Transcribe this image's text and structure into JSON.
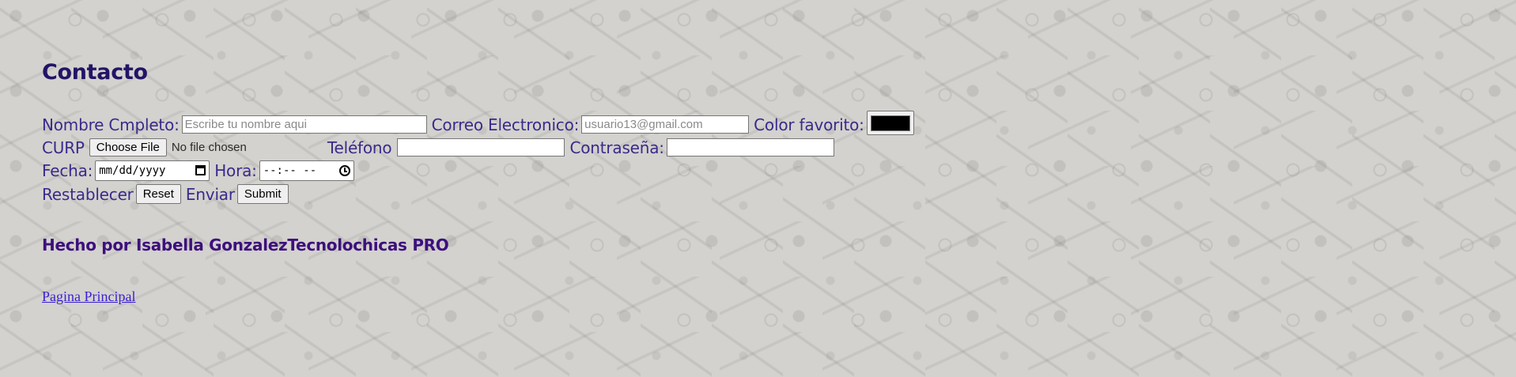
{
  "page": {
    "title": "Contacto",
    "background_color": "#d3d2ce",
    "heading_color": "#221466",
    "label_color": "#3a2a8c"
  },
  "form": {
    "nombre": {
      "label": "Nombre Cmpleto:",
      "placeholder": "Escribe tu nombre aqui",
      "value": ""
    },
    "correo": {
      "label": "Correo Electronico:",
      "placeholder": "usuario13@gmail.com",
      "value": ""
    },
    "color": {
      "label": "Color favorito:",
      "value": "#000000"
    },
    "curp": {
      "label": "CURP",
      "button_label": "Choose File",
      "status": "No file chosen"
    },
    "telefono": {
      "label": "Teléfono",
      "value": ""
    },
    "contrasena": {
      "label": "Contraseña:",
      "value": ""
    },
    "fecha": {
      "label": "Fecha:",
      "placeholder": "mm/dd/yyyy",
      "icon": "calendar-icon"
    },
    "hora": {
      "label": "Hora:",
      "placeholder": "--:-- --",
      "icon": "clock-icon"
    },
    "restablecer": {
      "label": "Restablecer",
      "button_label": "Reset"
    },
    "enviar": {
      "label": "Enviar",
      "button_label": "Submit"
    }
  },
  "footer": {
    "credit": "Hecho por Isabella GonzalezTecnolochicas PRO",
    "credit_color": "#3d0f7d",
    "link_label": "Pagina Principal",
    "link_color": "#3b1fd6"
  }
}
